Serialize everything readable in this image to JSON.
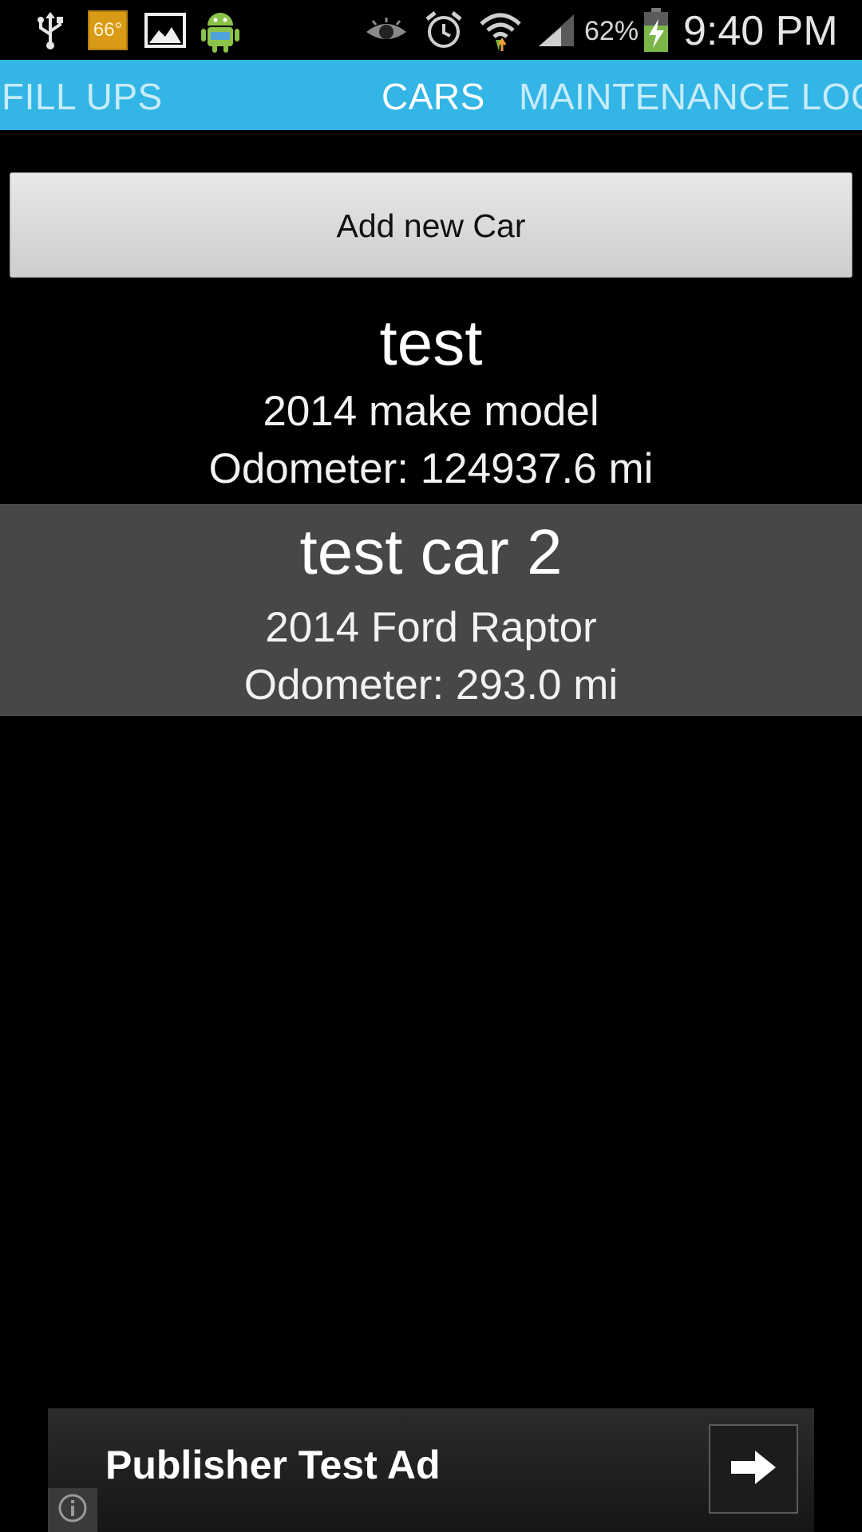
{
  "status_bar": {
    "temperature": "66°",
    "battery_percent": "62%",
    "time": "9:40 PM",
    "icons": [
      "usb-icon",
      "weather-icon",
      "gallery-icon",
      "android-icon",
      "eye-icon",
      "alarm-icon",
      "wifi-icon",
      "signal-icon",
      "battery-charging-icon"
    ]
  },
  "tabs": [
    {
      "label": "FILL UPS",
      "active": false
    },
    {
      "label": "CARS",
      "active": true
    },
    {
      "label": "MAINTENANCE LOG",
      "active": false
    }
  ],
  "add_button_label": "Add new Car",
  "cars": [
    {
      "name": "test",
      "year_make_model": "2014  make model",
      "odometer": "Odometer: 124937.6 mi",
      "selected": false
    },
    {
      "name": "test car 2",
      "year_make_model": "2014  Ford Raptor",
      "odometer": "Odometer: 293.0 mi",
      "selected": true
    }
  ],
  "ad": {
    "title": "Publisher Test Ad"
  },
  "colors": {
    "tab_bar": "#33b5e5",
    "background": "#000000",
    "selected_row": "#474747"
  }
}
